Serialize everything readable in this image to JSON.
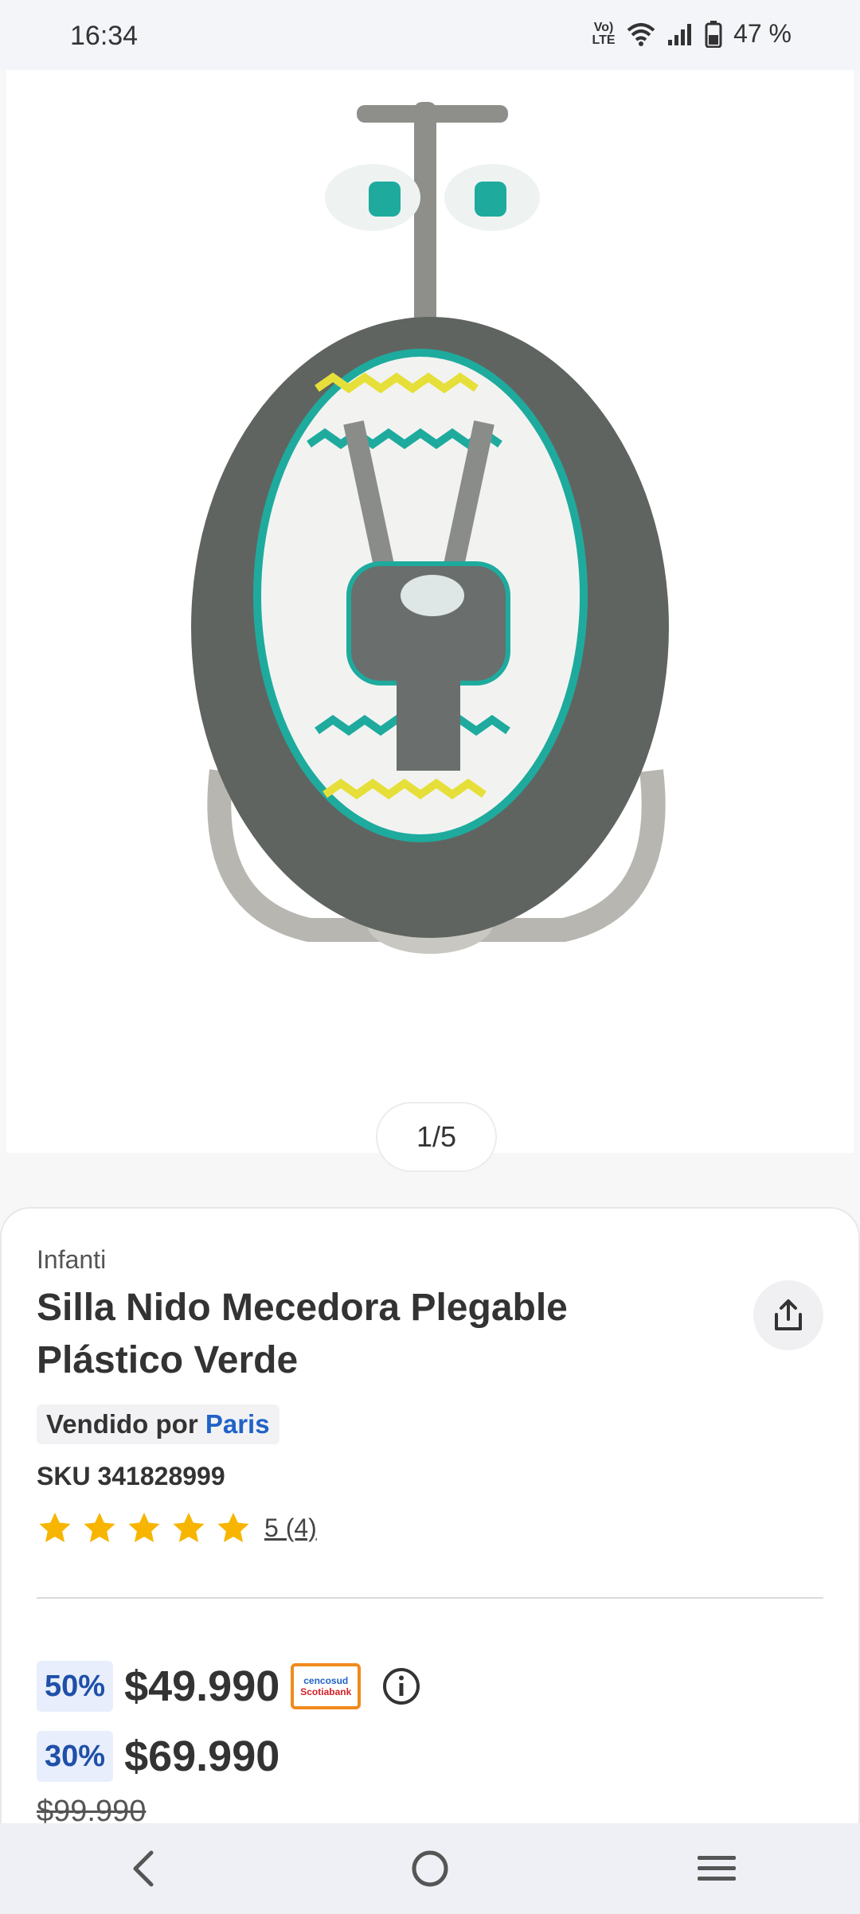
{
  "status_bar": {
    "time": "16:34",
    "volte": "VoLTE",
    "battery": "47 %"
  },
  "gallery": {
    "pager": "1/5"
  },
  "product": {
    "brand": "Infanti",
    "title": "Silla Nido Mecedora Plegable Plástico Verde",
    "sold_by_label": "Vendido por",
    "seller": "Paris",
    "sku": "SKU 341828999",
    "rating_value": 5,
    "rating_text": "5 (4)",
    "prices": [
      {
        "badge": "50%",
        "price": "$49.990",
        "card": {
          "l1": "cencosud",
          "l2": "Scotiabank"
        }
      },
      {
        "badge": "30%",
        "price": "$69.990"
      }
    ],
    "old_price": "$99.990"
  },
  "colors": {
    "accent": "#2063c7",
    "star": "#f7b500",
    "badge_bg": "#e8eefb"
  },
  "icons": {
    "share": "share-icon",
    "info": "info-icon",
    "back": "back-icon",
    "home": "home-icon",
    "menu": "menu-icon"
  }
}
